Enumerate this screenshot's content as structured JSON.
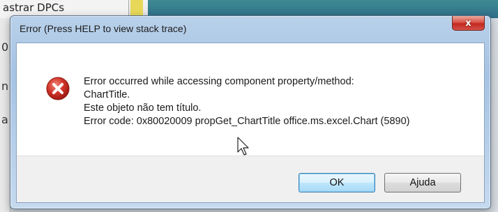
{
  "background": {
    "cell_text": "astrar DPCs",
    "left_letters": [
      "0",
      "n",
      "a"
    ]
  },
  "dialog": {
    "title": "Error (Press HELP to view stack trace)",
    "close_label": "x",
    "icon": "error-icon",
    "message_lines": [
      "Error occurred while accessing component property/method:",
      "ChartTitle.",
      "Este objeto não tem título.",
      "Error code: 0x80020009 propGet_ChartTitle office.ms.excel.Chart (5890)"
    ],
    "buttons": {
      "ok": "OK",
      "help": "Ajuda"
    }
  },
  "colors": {
    "close_button": "#c7372c",
    "error_icon": "#c9302c",
    "ok_button_border": "#3c7fb1"
  }
}
